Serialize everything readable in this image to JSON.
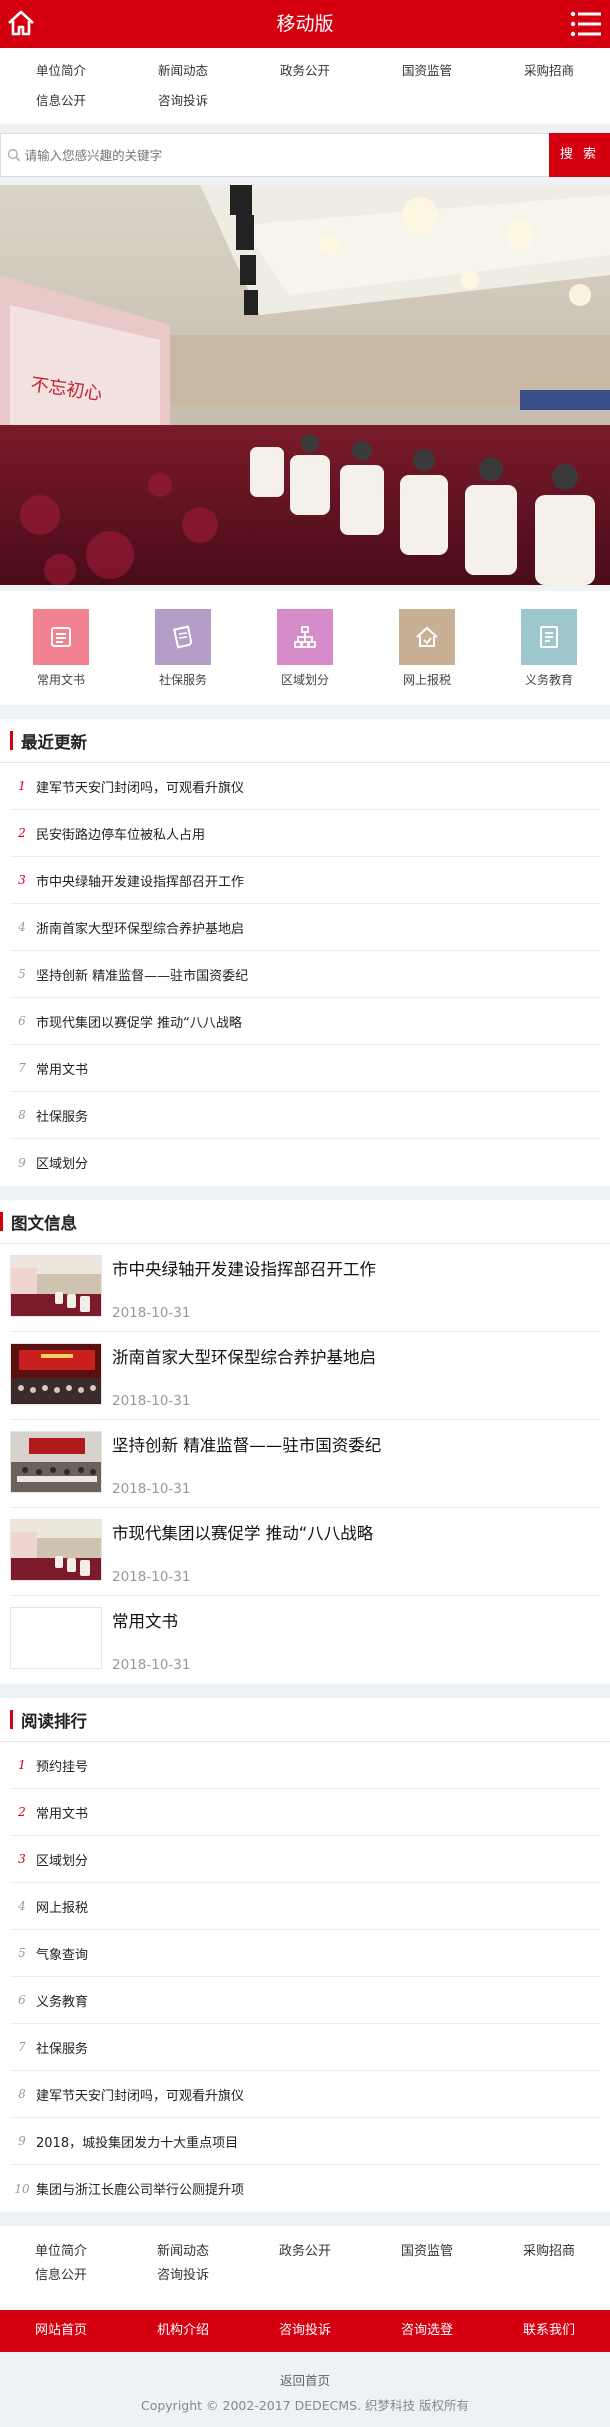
{
  "header": {
    "title": "移动版",
    "home_icon": "home-icon",
    "menu_icon": "menu-icon"
  },
  "nav": [
    "单位简介",
    "新闻动态",
    "政务公开",
    "国资监管",
    "采购招商",
    "信息公开",
    "咨询投诉"
  ],
  "search": {
    "placeholder": "请输入您感兴趣的关键字",
    "button": "搜 索"
  },
  "quick": [
    {
      "label": "常用文书",
      "color": "#f0838f",
      "icon": "document-icon"
    },
    {
      "label": "社保服务",
      "color": "#b49ec8",
      "icon": "paper-icon"
    },
    {
      "label": "区域划分",
      "color": "#d68cc8",
      "icon": "org-chart-icon"
    },
    {
      "label": "网上报税",
      "color": "#c7b094",
      "icon": "house-icon"
    },
    {
      "label": "义务教育",
      "color": "#9ec7cd",
      "icon": "book-icon"
    }
  ],
  "latest": {
    "title": "最近更新",
    "items": [
      {
        "num": "1",
        "text": "建军节天安门封闭吗，可观看升旗仪"
      },
      {
        "num": "2",
        "text": "民安街路边停车位被私人占用"
      },
      {
        "num": "3",
        "text": "市中央绿轴开发建设指挥部召开工作"
      },
      {
        "num": "4",
        "text": "浙南首家大型环保型综合养护基地启"
      },
      {
        "num": "5",
        "text": "坚持创新 精准监督——驻市国资委纪"
      },
      {
        "num": "6",
        "text": "市现代集团以赛促学 推动“八八战略"
      },
      {
        "num": "7",
        "text": "常用文书"
      },
      {
        "num": "8",
        "text": "社保服务"
      },
      {
        "num": "9",
        "text": "区域划分"
      }
    ]
  },
  "pics": {
    "title": "图文信息",
    "items": [
      {
        "title": "市中央绿轴开发建设指挥部召开工作",
        "date": "2018-10-31",
        "thumb": "hall"
      },
      {
        "title": "浙南首家大型环保型综合养护基地启",
        "date": "2018-10-31",
        "thumb": "stage"
      },
      {
        "title": "坚持创新 精准监督——驻市国资委纪",
        "date": "2018-10-31",
        "thumb": "meeting"
      },
      {
        "title": "市现代集团以赛促学 推动“八八战略",
        "date": "2018-10-31",
        "thumb": "hall"
      },
      {
        "title": "常用文书",
        "date": "2018-10-31",
        "thumb": "blank"
      }
    ]
  },
  "ranking": {
    "title": "阅读排行",
    "items": [
      {
        "num": "1",
        "text": "预约挂号"
      },
      {
        "num": "2",
        "text": "常用文书"
      },
      {
        "num": "3",
        "text": "区域划分"
      },
      {
        "num": "4",
        "text": "网上报税"
      },
      {
        "num": "5",
        "text": "气象查询"
      },
      {
        "num": "6",
        "text": "义务教育"
      },
      {
        "num": "7",
        "text": "社保服务"
      },
      {
        "num": "8",
        "text": "建军节天安门封闭吗，可观看升旗仪"
      },
      {
        "num": "9",
        "text": "2018，城投集团发力十大重点项目"
      },
      {
        "num": "10",
        "text": "集团与浙江长鹿公司举行公厕提升项"
      }
    ]
  },
  "footer_nav": [
    "单位简介",
    "新闻动态",
    "政务公开",
    "国资监管",
    "采购招商",
    "信息公开",
    "咨询投诉"
  ],
  "footer_bar": [
    "网站首页",
    "机构介绍",
    "咨询投诉",
    "咨询选登",
    "联系我们"
  ],
  "copyright": {
    "back": "返回首页",
    "text": "Copyright © 2002-2017 DEDECMS. 织梦科技 版权所有"
  },
  "colors": {
    "brand": "#d4000f",
    "num_red": "#d4000f",
    "num_gray": "#999999"
  }
}
